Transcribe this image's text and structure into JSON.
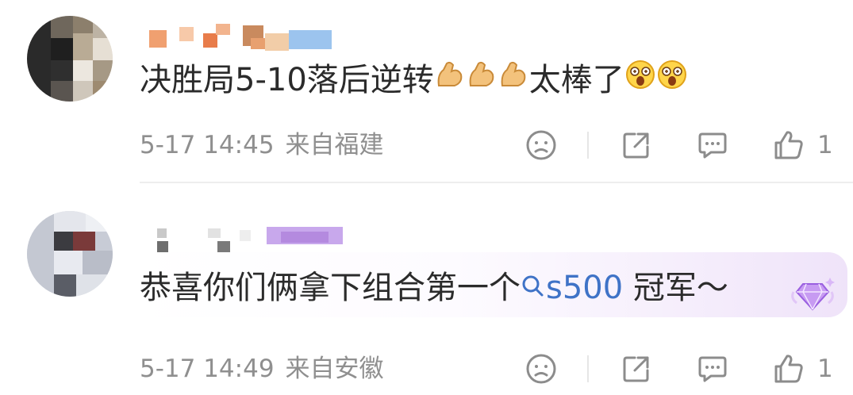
{
  "comments": [
    {
      "avatar_icon": "blurred-avatar",
      "username_icon": "blurred-username",
      "content_text": "决胜局5-10落后逆转",
      "content_emojis": [
        "flexed-biceps",
        "flexed-biceps",
        "flexed-biceps"
      ],
      "content_text_2": "太棒了",
      "content_emojis_2": [
        "wow-face",
        "wow-face"
      ],
      "timestamp": "5-17 14:45",
      "location": "来自福建",
      "like_count": "1"
    },
    {
      "avatar_icon": "blurred-avatar",
      "username_icon": "blurred-username",
      "content_text": "恭喜你们俩拿下组合第一个",
      "topic_link": "s500",
      "topic_icon": "search-icon",
      "content_text_2": " 冠军～",
      "badge_icon": "vip-diamond-badge",
      "timestamp": "5-17 14:49",
      "location": "来自安徽",
      "like_count": "1"
    }
  ],
  "colors": {
    "text": "#2b2b2b",
    "meta": "#8f8f8f",
    "link": "#3f73c7",
    "bubble_accent": "#efe3f9",
    "icon": "#8c8c8c"
  }
}
